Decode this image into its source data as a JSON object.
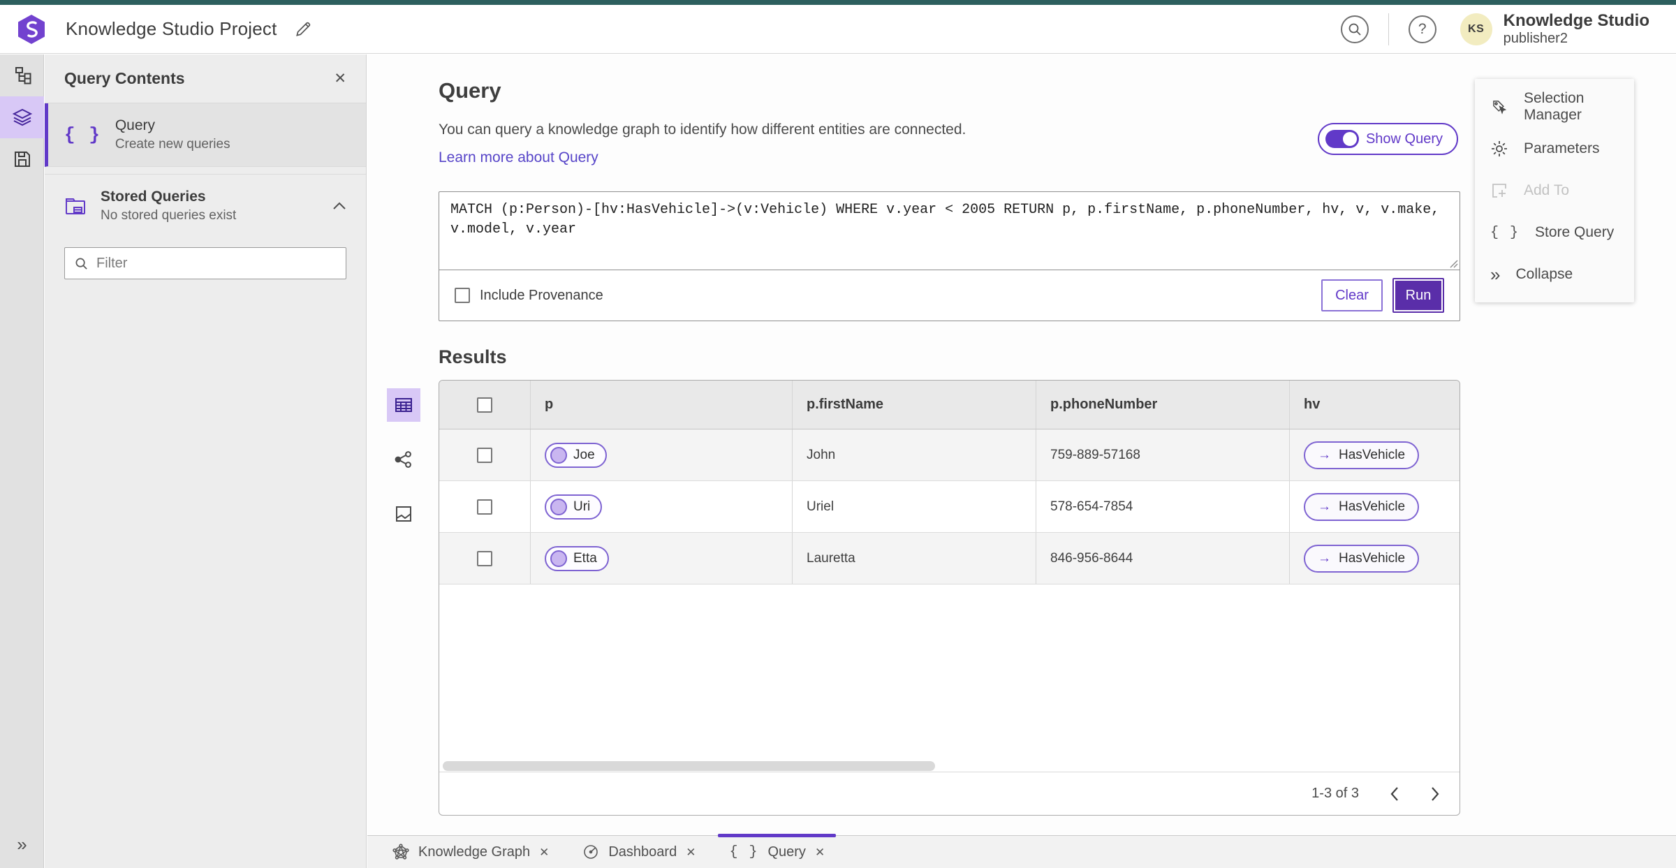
{
  "header": {
    "project_title": "Knowledge Studio Project",
    "product_name": "Knowledge Studio",
    "user_name": "publisher2",
    "avatar_initials": "KS",
    "help_glyph": "?"
  },
  "left_panel": {
    "title": "Query Contents",
    "items": [
      {
        "label": "Query",
        "sublabel": "Create new queries"
      },
      {
        "label": "Stored Queries",
        "sublabel": "No stored queries exist"
      }
    ],
    "filter_placeholder": "Filter"
  },
  "query_section": {
    "title": "Query",
    "description": "You can query a knowledge graph to identify how different entities are connected.",
    "learn_more": "Learn more about Query",
    "show_query_label": "Show Query",
    "query_text": "MATCH (p:Person)-[hv:HasVehicle]->(v:Vehicle) WHERE v.year < 2005 RETURN p, p.firstName, p.phoneNumber, hv, v, v.make, v.model, v.year",
    "include_provenance_label": "Include Provenance",
    "clear_label": "Clear",
    "run_label": "Run"
  },
  "results": {
    "title": "Results",
    "columns": [
      "p",
      "p.firstName",
      "p.phoneNumber",
      "hv"
    ],
    "rows": [
      {
        "p": "Joe",
        "firstName": "John",
        "phoneNumber": "759-889-57168",
        "hv": "HasVehicle"
      },
      {
        "p": "Uri",
        "firstName": "Uriel",
        "phoneNumber": "578-654-7854",
        "hv": "HasVehicle"
      },
      {
        "p": "Etta",
        "firstName": "Lauretta",
        "phoneNumber": "846-956-8644",
        "hv": "HasVehicle"
      }
    ],
    "pagination": "1-3 of 3"
  },
  "tools_panel": {
    "items": [
      {
        "label": "Selection Manager"
      },
      {
        "label": "Parameters"
      },
      {
        "label": "Add To"
      },
      {
        "label": "Store Query"
      },
      {
        "label": "Collapse"
      }
    ]
  },
  "bottom_tabs": [
    {
      "label": "Knowledge Graph"
    },
    {
      "label": "Dashboard"
    },
    {
      "label": "Query"
    }
  ],
  "colors": {
    "accent": "#6139c8",
    "accent_dark": "#5a2ea9",
    "accent_light": "#d8c8f6",
    "teal": "#2d5f5e",
    "pill_border": "#7e63d2",
    "pill_fill": "#c9b6f0",
    "avatar_bg": "#f2ecc0",
    "link": "#5644c8"
  }
}
